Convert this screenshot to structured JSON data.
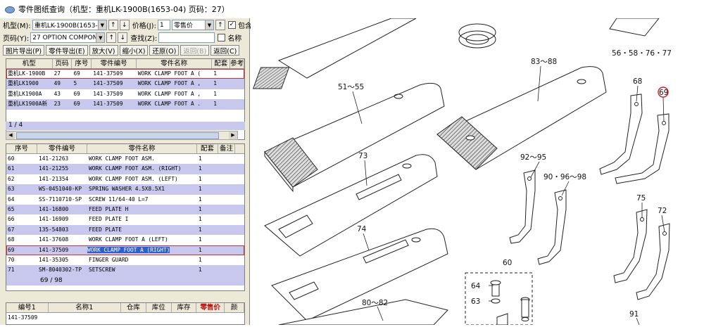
{
  "window": {
    "title": "零件图纸查询（机型：重机LK-1900B(1653-04) 页码：27）"
  },
  "filters": {
    "model_label": "机型(M):",
    "model_value": "重机LK-1900B(1653-",
    "price_label": "价格(J):",
    "price_value": "1",
    "price_type": "零售价",
    "include_label": "包含",
    "page_label": "页码(Y):",
    "page_value": "27 OPTION COMPONE",
    "find_label": "查找(Z):",
    "find_value": "",
    "name_label": "名称"
  },
  "toolbar": {
    "export_drawing": "图片导出(P)",
    "export_parts": "零件导出(E)",
    "zoom_in": "放大(V)",
    "zoom_out": "缩小(X)",
    "restore": "还原(O)",
    "restore_disabled": "返回(B)",
    "back": "返回(C)"
  },
  "models_table": {
    "headers": [
      "机型",
      "页码",
      "序号",
      "零件编号",
      "零件名称",
      "配套",
      "参考"
    ],
    "rows": [
      [
        "重机LK-1900B",
        "27",
        "69",
        "141-37509",
        "WORK CLAMP FOOT A (",
        "1",
        ""
      ],
      [
        "重机LK1900",
        "49",
        "5",
        "141-37509",
        "WORK CLAMP FOOT A ,",
        "1",
        ""
      ],
      [
        "重机LK1900A",
        "43",
        "69",
        "141-37509",
        "WORK CLAMP FOOT A ,",
        "1",
        ""
      ],
      [
        "重机LK1900A新",
        "23",
        "69",
        "141-37509",
        "WORK CLAMP FOOT A .",
        "1",
        ""
      ]
    ],
    "status": "1 / 4"
  },
  "parts_table": {
    "headers": [
      "序号",
      "零件编号",
      "零件名称",
      "配套",
      "备注"
    ],
    "rows": [
      [
        "60",
        "141-21263",
        "WORK CLAMP FOOT ASM.",
        "1"
      ],
      [
        "61",
        "141-21255",
        "WORK CLAMP FOOT ASM. (RIGHT)",
        "1"
      ],
      [
        "62",
        "141-21354",
        "WORK CLAMP FOOT ASM. (LEFT)",
        "1"
      ],
      [
        "63",
        "WS-0451040-KP",
        "SPRING WASHER 4.5X8.5X1",
        "1"
      ],
      [
        "64",
        "SS-7110710-SP",
        "SCREW 11/64-40 L=7",
        "1"
      ],
      [
        "65",
        "141-16800",
        "FEED PLATE H",
        "1"
      ],
      [
        "66",
        "141-16909",
        "FEED PLATE I",
        "1"
      ],
      [
        "67",
        "135-54803",
        "FEED PLATE",
        "1"
      ],
      [
        "68",
        "141-37608",
        "WORK CLAMP FOOT A (LEFT)",
        "1"
      ],
      [
        "69",
        "141-37509",
        "WORK CLAMP FOOT A (RIGHT)",
        "1"
      ],
      [
        "70",
        "141-35305",
        "FINGER GUARD",
        "1"
      ],
      [
        "71",
        "SM-8040302-TP",
        "SETSCREW",
        "1"
      ]
    ],
    "status": "69 / 98"
  },
  "stock_table": {
    "headers": [
      "编号1",
      "名称1",
      "仓库",
      "库位",
      "库存",
      "零售价",
      "颜"
    ],
    "rows": [
      [
        "141-37509",
        "",
        "",
        "",
        "",
        "",
        ""
      ]
    ]
  },
  "drawing": {
    "labels": [
      "56・58・76・77",
      "83～88",
      "51～55",
      "68",
      "69",
      "73",
      "92～95",
      "90・96～98",
      "74",
      "75",
      "72",
      "60",
      "64",
      "63",
      "80～82",
      "91"
    ],
    "highlight_color": "#d02020"
  }
}
